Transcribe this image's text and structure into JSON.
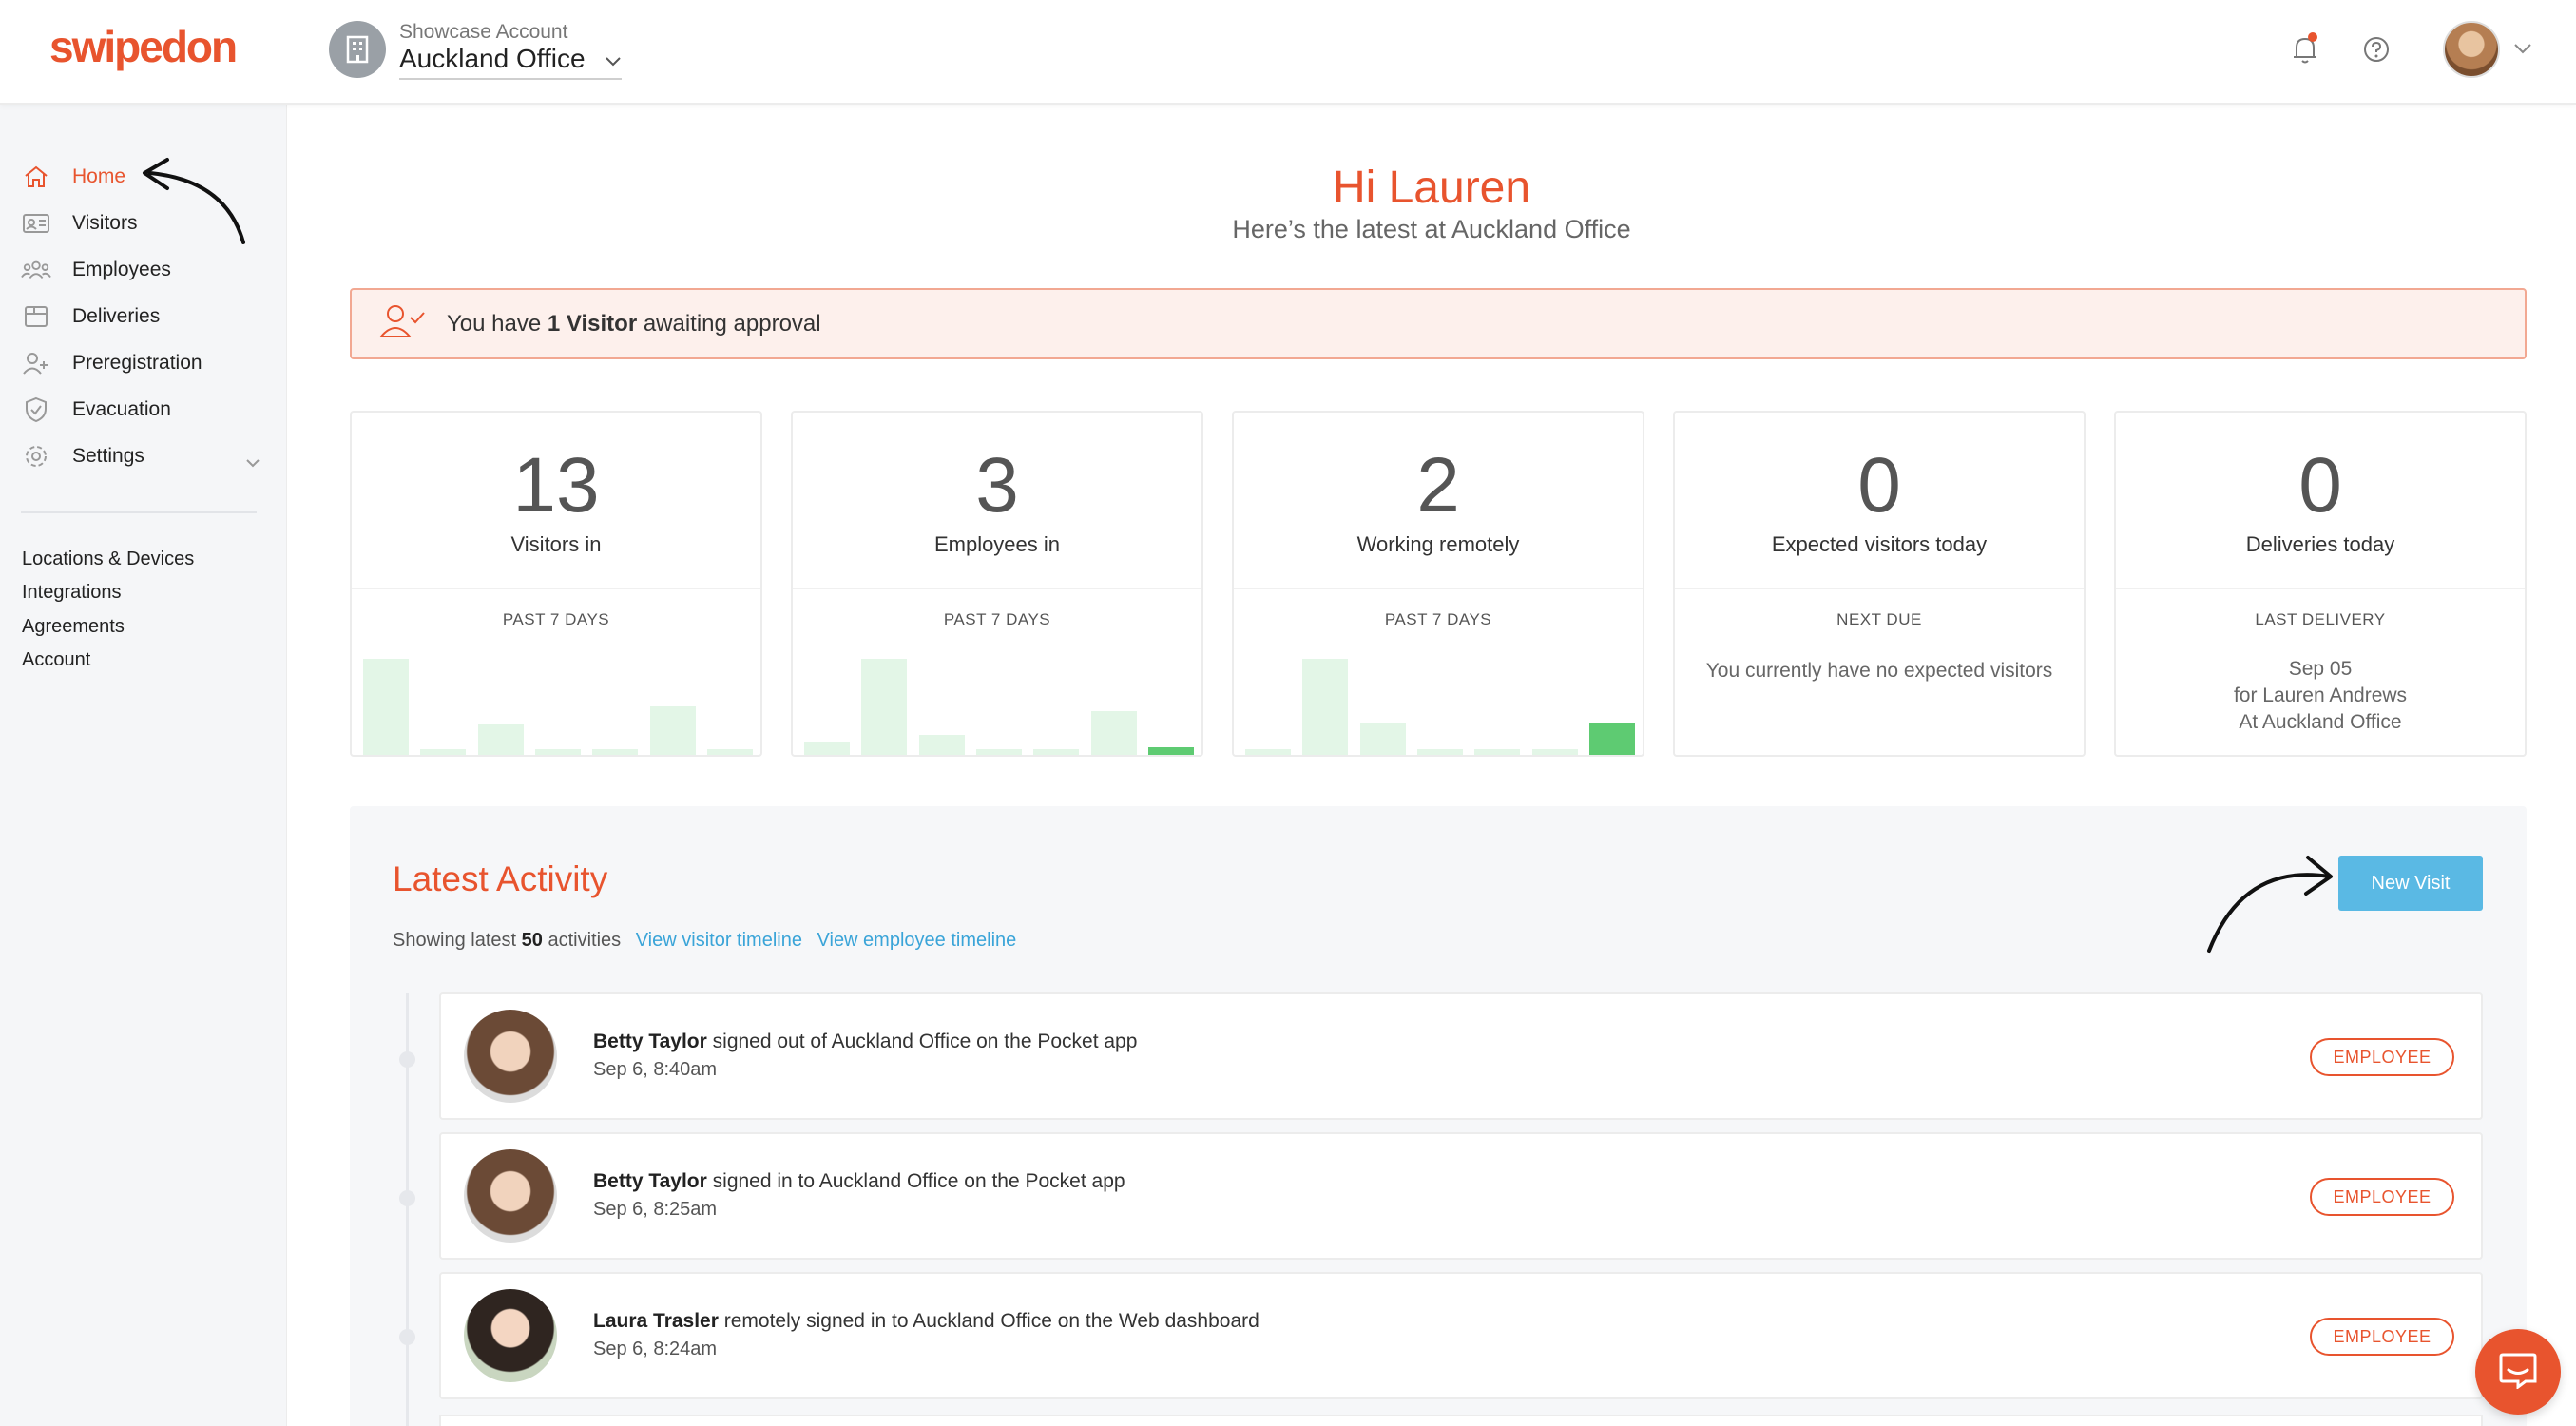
{
  "header": {
    "logo": "swipedon",
    "account_sub": "Showcase Account",
    "account_name": "Auckland Office"
  },
  "sidebar": {
    "items": [
      {
        "label": "Home",
        "icon": "home-icon",
        "active": true
      },
      {
        "label": "Visitors",
        "icon": "id-card-icon"
      },
      {
        "label": "Employees",
        "icon": "users-icon"
      },
      {
        "label": "Deliveries",
        "icon": "package-icon"
      },
      {
        "label": "Preregistration",
        "icon": "user-plus-icon"
      },
      {
        "label": "Evacuation",
        "icon": "shield-icon"
      },
      {
        "label": "Settings",
        "icon": "gear-icon"
      }
    ],
    "links": [
      "Locations & Devices",
      "Integrations",
      "Agreements",
      "Account"
    ]
  },
  "greeting": {
    "title": "Hi Lauren",
    "subtitle": "Here’s the latest at Auckland Office"
  },
  "alert": {
    "prefix": "You have ",
    "bold": "1 Visitor",
    "suffix": " awaiting approval"
  },
  "stats": [
    {
      "value": "13",
      "label": "Visitors in",
      "caption": "PAST 7 DAYS",
      "bars": [
        0.95,
        0.05,
        0.3,
        0.05,
        0.05,
        0.48,
        0.05
      ],
      "highlight": [
        false,
        false,
        false,
        false,
        false,
        false,
        false
      ]
    },
    {
      "value": "3",
      "label": "Employees in",
      "caption": "PAST 7 DAYS",
      "bars": [
        0.12,
        0.95,
        0.2,
        0.05,
        0.05,
        0.43,
        0.08
      ],
      "highlight": [
        false,
        false,
        false,
        false,
        false,
        false,
        true
      ]
    },
    {
      "value": "2",
      "label": "Working remotely",
      "caption": "PAST 7 DAYS",
      "bars": [
        0.05,
        0.95,
        0.32,
        0.05,
        0.05,
        0.05,
        0.32
      ],
      "highlight": [
        false,
        false,
        false,
        false,
        false,
        false,
        true
      ]
    },
    {
      "value": "0",
      "label": "Expected visitors today",
      "caption": "NEXT DUE",
      "note": "You currently have no expected visitors"
    },
    {
      "value": "0",
      "label": "Deliveries today",
      "caption": "LAST DELIVERY",
      "note_lines": [
        "Sep 05",
        "for Lauren Andrews",
        "At Auckland Office"
      ]
    }
  ],
  "activity": {
    "title": "Latest Activity",
    "showing_prefix": "Showing latest ",
    "count": "50",
    "showing_suffix": " activities",
    "link_visitor": "View visitor timeline",
    "link_employee": "View employee timeline",
    "new_visit": "New Visit",
    "rows": [
      {
        "name": "Betty Taylor",
        "action": " signed out of Auckland Office on the Pocket app",
        "time": "Sep 6, 8:40am",
        "badge": "EMPLOYEE"
      },
      {
        "name": "Betty Taylor",
        "action": " signed in to Auckland Office on the Pocket app",
        "time": "Sep 6, 8:25am",
        "badge": "EMPLOYEE"
      },
      {
        "name": "Laura Trasler",
        "action": " remotely signed in to Auckland Office on the Web dashboard",
        "time": "Sep 6, 8:24am",
        "badge": "EMPLOYEE"
      }
    ]
  },
  "colors": {
    "accent": "#e8542e",
    "link": "#3aa4d8",
    "button": "#5ab9e4",
    "bar": "#e3f6e7",
    "bar_highlight": "#5ecb72"
  }
}
